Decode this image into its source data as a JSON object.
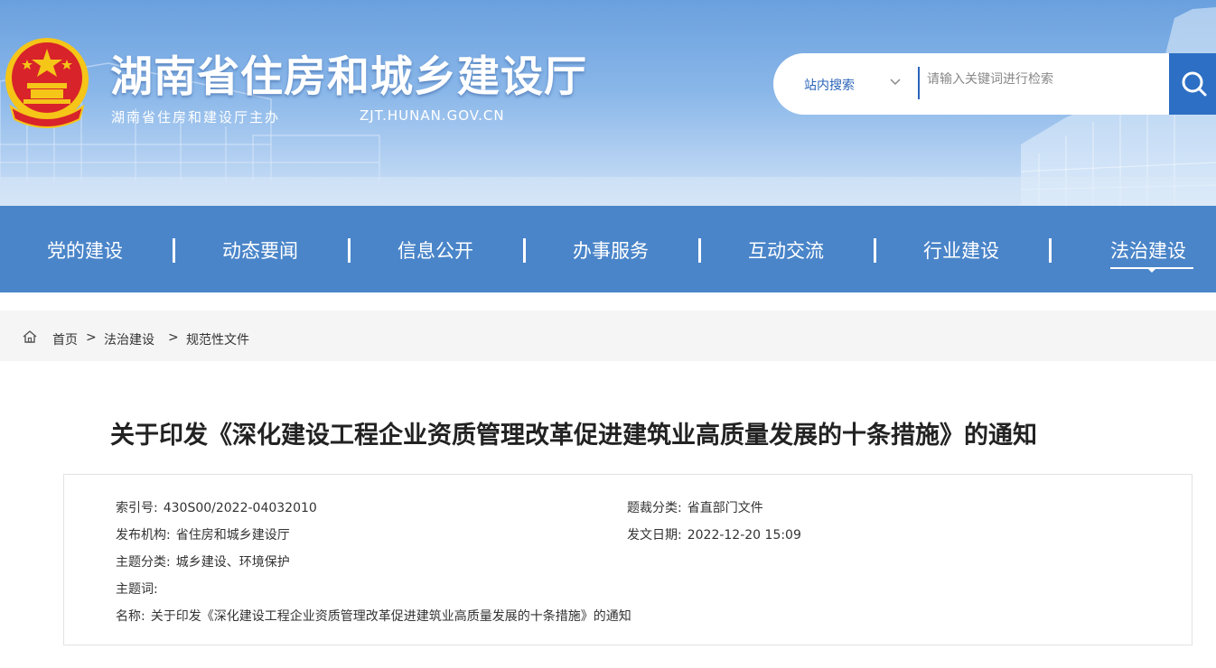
{
  "header": {
    "title": "湖南省住房和城乡建设厅",
    "subtitle": "湖南省住房和建设厅主办",
    "url": "ZJT.HUNAN.GOV.CN"
  },
  "search": {
    "scope": "站内搜索",
    "placeholder": "请输入关键词进行检索"
  },
  "nav": {
    "items": [
      {
        "label": "党的建设"
      },
      {
        "label": "动态要闻"
      },
      {
        "label": "信息公开"
      },
      {
        "label": "办事服务"
      },
      {
        "label": "互动交流"
      },
      {
        "label": "行业建设"
      },
      {
        "label": "法治建设",
        "active": true
      }
    ]
  },
  "breadcrumb": {
    "home": "首页",
    "sep": ">",
    "level1": "法治建设",
    "level2": "规范性文件"
  },
  "article": {
    "title": "关于印发《深化建设工程企业资质管理改革促进建筑业高质量发展的十条措施》的通知",
    "meta": {
      "index_label": "索引号:",
      "index_value": "430S00/2022-04032010",
      "category_label": "题裁分类:",
      "category_value": "省直部门文件",
      "publisher_label": "发布机构:",
      "publisher_value": "省住房和城乡建设厅",
      "date_label": "发文日期:",
      "date_value": "2022-12-20 15:09",
      "topic_label": "主题分类:",
      "topic_value": "城乡建设、环境保护",
      "keywords_label": "主题词:",
      "keywords_value": "",
      "name_label": "名称:",
      "name_value": "关于印发《深化建设工程企业资质管理改革促进建筑业高质量发展的十条措施》的通知"
    }
  },
  "colors": {
    "nav_bg": "#4a85c9",
    "accent": "#2d6fc4",
    "emblem_red": "#d8232a",
    "emblem_gold": "#f5c518"
  },
  "icons": {
    "emblem": "national-emblem-icon",
    "search": "search-icon",
    "dropdown": "chevron-down-icon",
    "home": "home-icon"
  }
}
